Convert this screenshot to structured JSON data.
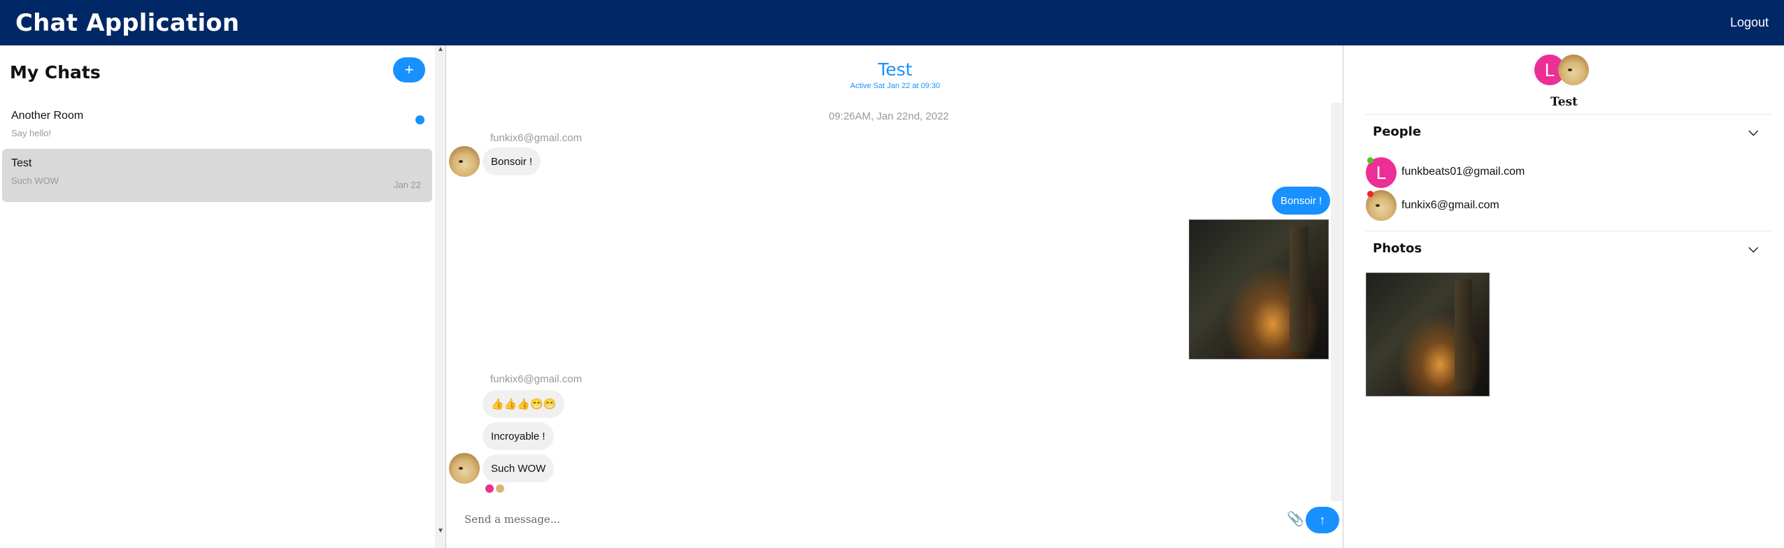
{
  "navbar": {
    "title": "Chat Application",
    "logout": "Logout"
  },
  "chat_list": {
    "title": "My Chats",
    "new_chat_icon": "plus-icon",
    "new_chat_symbol": "+",
    "chats": [
      {
        "name": "Another Room",
        "preview": "Say hello!",
        "date": "",
        "unread": true,
        "active": false
      },
      {
        "name": "Test",
        "preview": "Such WOW",
        "date": "Jan 22",
        "unread": false,
        "active": true
      }
    ]
  },
  "feed": {
    "title": "Test",
    "subtitle": "Active Sat Jan 22 at 09:30",
    "timestamp": "09:26AM, Jan 22nd, 2022",
    "messages": [
      {
        "sender": "funkix6@gmail.com",
        "text": "Bonsoir !"
      },
      {
        "mine": true,
        "text": "Bonsoir !"
      },
      {
        "mine": true,
        "image": "photo-attachment"
      },
      {
        "sender": "funkix6@gmail.com",
        "text": "👍👍👍😁😁"
      },
      {
        "text": "Incroyable !"
      },
      {
        "text": "Such WOW"
      }
    ],
    "composer": {
      "placeholder": "Send a message...",
      "attach_icon": "paperclip-icon",
      "send_icon": "arrow-up-icon",
      "attach_symbol": "📎",
      "send_symbol": "↑"
    }
  },
  "settings": {
    "title": "Test",
    "avatar_letter": "L",
    "people_label": "People",
    "photos_label": "Photos",
    "people": [
      {
        "email": "funkbeats01@gmail.com",
        "avatar_letter": "L",
        "status_color": "#52c41a"
      },
      {
        "email": "funkix6@gmail.com",
        "status_color": "#f5222d"
      }
    ],
    "chevron_symbol": "⌵"
  },
  "colors": {
    "navbar": "#002766",
    "accent": "#1890ff",
    "avatar_L": "#eb2f96"
  }
}
